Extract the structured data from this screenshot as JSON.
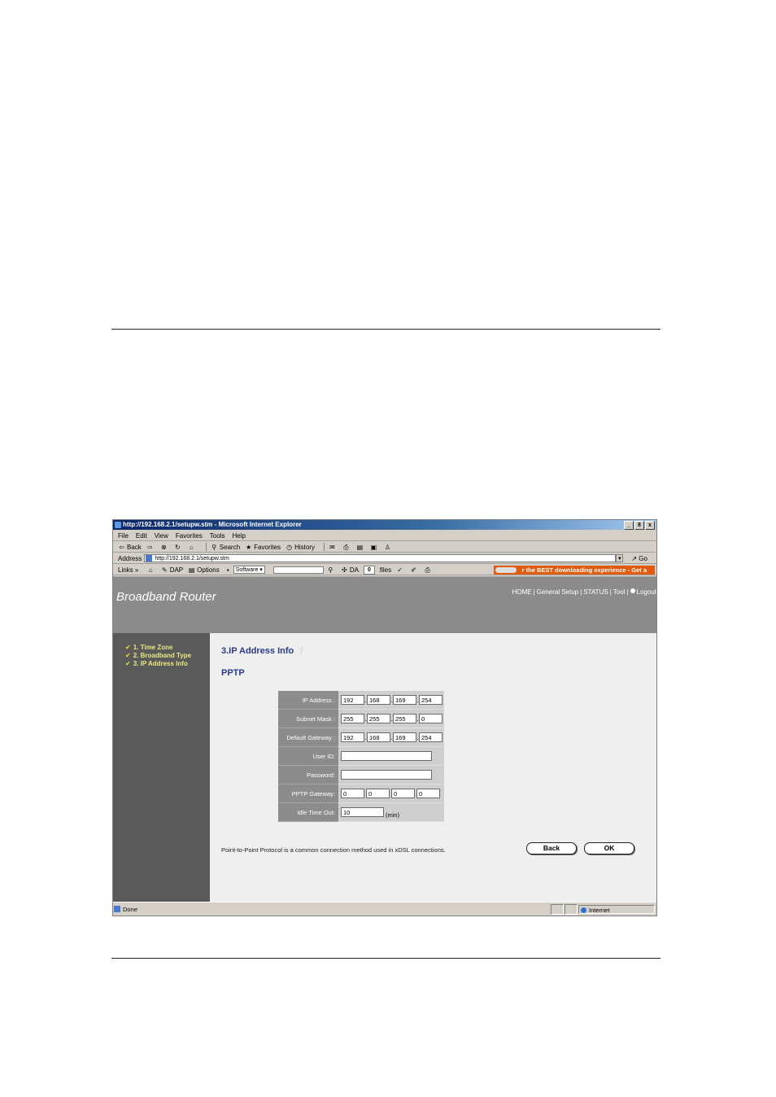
{
  "window": {
    "title": "http://192.168.2.1/setupw.stm - Microsoft Internet Explorer",
    "controls": [
      "_",
      "8",
      "x"
    ]
  },
  "menu": [
    "File",
    "Edit",
    "View",
    "Favorites",
    "Tools",
    "Help"
  ],
  "toolbar": {
    "back": "Back",
    "search": "Search",
    "favorites": "Favorites",
    "history": "History"
  },
  "address": {
    "label": "Address",
    "url": "http://192.168.2.1/setupw.stm",
    "go": "Go"
  },
  "links": {
    "label": "Links",
    "dap": "DAP",
    "options": "Options",
    "software": "Software",
    "da": "DA",
    "count": "0",
    "files": "files",
    "banner": "r the BEST downloading experience - Get a"
  },
  "router": {
    "brand": "Broadband Router",
    "nav": [
      "HOME",
      "General Setup",
      "STATUS",
      "Tool",
      "Logout"
    ],
    "steps": [
      "1. Time Zone",
      "2. Broadband Type",
      "3. IP Address Info"
    ],
    "section_title": "3.IP Address Info",
    "subtitle": "PPTP",
    "fields": {
      "ip_label": "IP Address :",
      "ip": [
        "192",
        "168",
        "169",
        "254"
      ],
      "mask_label": "Subnet Mask :",
      "mask": [
        "255",
        "255",
        "255",
        "0"
      ],
      "gw_label": "Default Gateway :",
      "gw": [
        "192",
        "168",
        "169",
        "254"
      ],
      "user_label": "User ID:",
      "pass_label": "Password:",
      "pptp_gw_label": "PPTP Gateway:",
      "pptp_gw": [
        "0",
        "0",
        "0",
        "0"
      ],
      "idle_label": "Idle Time Out:",
      "idle": "10",
      "idle_unit": "(min)"
    },
    "description": "Point-to-Point Protocol is a common connection method used in xDSL connections.",
    "back": "Back",
    "ok": "OK"
  },
  "status": {
    "text": "Done",
    "zone": "Internet"
  }
}
